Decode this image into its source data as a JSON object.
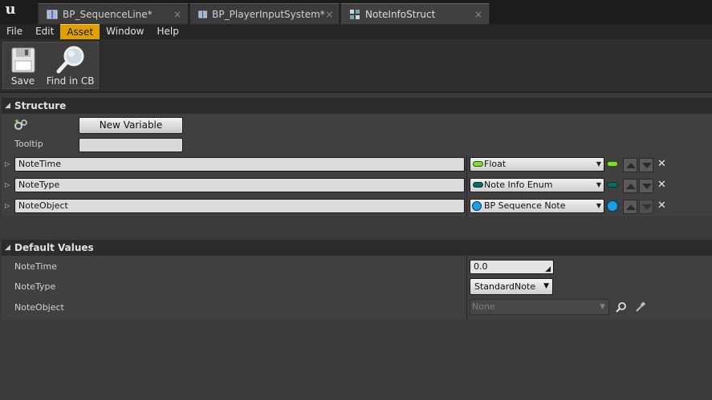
{
  "tabs": [
    {
      "label": "BP_SequenceLine*",
      "icon": "blueprint-book-icon",
      "close": "×"
    },
    {
      "label": "BP_PlayerInputSystem*",
      "icon": "blueprint-book-icon",
      "close": "×"
    },
    {
      "label": "NoteInfoStruct",
      "icon": "struct-icon",
      "close": "×"
    }
  ],
  "logo_text": "u",
  "menu": [
    "File",
    "Edit",
    "Asset",
    "Window",
    "Help"
  ],
  "active_menu": "Asset",
  "toolbar": {
    "save_label": "Save",
    "find_label": "Find in CB"
  },
  "structure": {
    "title": "Structure",
    "new_variable_label": "New Variable",
    "tooltip_label": "Tooltip",
    "tooltip_value": "",
    "variables": [
      {
        "name": "NoteTime",
        "type": "Float",
        "type_color": "#7fe02a",
        "pin_shape": "pill"
      },
      {
        "name": "NoteType",
        "type": "Note Info Enum",
        "type_color": "#0a6e5e",
        "pin_shape": "pill"
      },
      {
        "name": "NoteObject",
        "type": "BP Sequence Note",
        "type_color": "#1aa0e8",
        "pin_shape": "dot"
      }
    ]
  },
  "defaults": {
    "title": "Default Values",
    "note_time_label": "NoteTime",
    "note_time_value": "0.0",
    "note_type_label": "NoteType",
    "note_type_value": "StandardNote",
    "note_object_label": "NoteObject",
    "note_object_value": "None"
  },
  "colors": {
    "accent": "#e2a000",
    "float_pin": "#7fe02a",
    "enum_pin": "#0a6e5e",
    "object_pin": "#1aa0e8"
  }
}
